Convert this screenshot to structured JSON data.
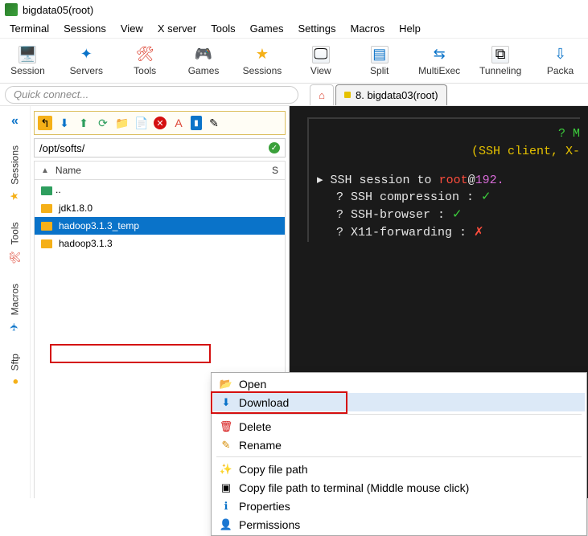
{
  "title_bar": {
    "title": "bigdata05(root)"
  },
  "menu": {
    "items": [
      "Terminal",
      "Sessions",
      "View",
      "X server",
      "Tools",
      "Games",
      "Settings",
      "Macros",
      "Help"
    ]
  },
  "toolbar": {
    "items": [
      {
        "label": "Session",
        "icon": "🖥️"
      },
      {
        "label": "Servers",
        "icon": "✦"
      },
      {
        "label": "Tools",
        "icon": "🛠"
      },
      {
        "label": "Games",
        "icon": "🎮"
      },
      {
        "label": "Sessions",
        "icon": "★"
      },
      {
        "label": "View",
        "icon": "🖵"
      },
      {
        "label": "Split",
        "icon": "▤"
      },
      {
        "label": "MultiExec",
        "icon": "⇆"
      },
      {
        "label": "Tunneling",
        "icon": "⧉"
      },
      {
        "label": "Packa",
        "icon": "⇩"
      }
    ]
  },
  "quick_connect": {
    "placeholder": "Quick connect..."
  },
  "tabs": {
    "session_label": "8. bigdata03(root)"
  },
  "side_tabs": [
    "Sessions",
    "Tools",
    "Macros",
    "Sftp"
  ],
  "path": {
    "value": "/opt/softs/"
  },
  "columns": {
    "name": "Name",
    "second": "S"
  },
  "files": {
    "items": [
      {
        "name": "..",
        "type": "up"
      },
      {
        "name": "jdk1.8.0",
        "type": "folder"
      },
      {
        "name": "hadoop3.1.3_temp",
        "type": "folder",
        "selected": true
      },
      {
        "name": "hadoop3.1.3",
        "type": "folder"
      }
    ]
  },
  "context_menu": {
    "items": [
      {
        "label": "Open",
        "icon": "📂"
      },
      {
        "label": "Download",
        "icon": "⬇",
        "hover": true
      },
      {
        "sep": true
      },
      {
        "label": "Delete",
        "icon": "🗑"
      },
      {
        "label": "Rename",
        "icon": "✎"
      },
      {
        "sep": true
      },
      {
        "label": "Copy file path",
        "icon": "✨"
      },
      {
        "label": "Copy file path to terminal (Middle mouse click)",
        "icon": "▣"
      },
      {
        "label": "Properties",
        "icon": "ℹ"
      },
      {
        "label": "Permissions",
        "icon": "👤"
      }
    ]
  },
  "terminal": {
    "line1_right": "? M",
    "line2": "(SSH client, X-",
    "line3_pre": "SSH session to ",
    "line3_user": "root",
    "line3_at": "@",
    "line3_host": "192.",
    "line4": "? SSH compression :",
    "line5": "? SSH-browser     :",
    "line6": "? X11-forwarding  :"
  }
}
